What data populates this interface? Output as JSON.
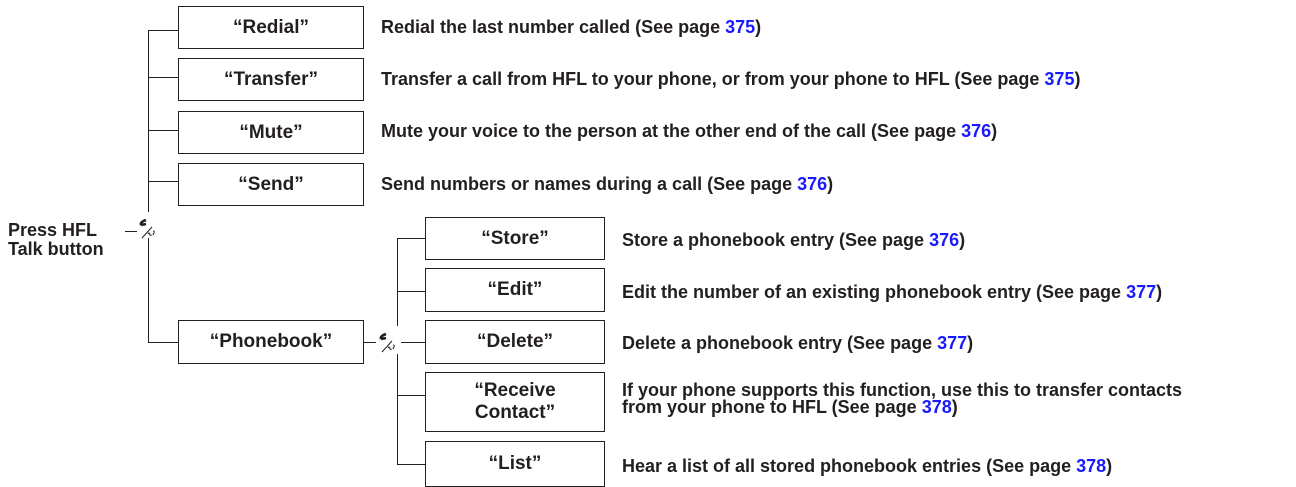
{
  "root": {
    "line1": "Press HFL",
    "line2": "Talk button"
  },
  "colors": {
    "text": "#231f20",
    "link": "#1a1aff"
  },
  "icons": [
    "voice-command-icon",
    "voice-command-icon"
  ],
  "level1": [
    {
      "key": "redial",
      "label": "“Redial”",
      "desc": "Redial the last number called (See page ",
      "page": "375",
      "tail": ")"
    },
    {
      "key": "transfer",
      "label": "“Transfer”",
      "desc": "Transfer a call from HFL to your phone, or from your phone to HFL (See page ",
      "page": "375",
      "tail": ")"
    },
    {
      "key": "mute",
      "label": "“Mute”",
      "desc": "Mute your voice to the person at the other end of the call (See page ",
      "page": "376",
      "tail": ")"
    },
    {
      "key": "send",
      "label": "“Send”",
      "desc": "Send numbers or names during a call (See page ",
      "page": "376",
      "tail": ")"
    },
    {
      "key": "phonebook",
      "label": "“Phonebook”"
    }
  ],
  "level2": [
    {
      "key": "store",
      "label": "“Store”",
      "desc": "Store a phonebook entry (See page ",
      "page": "376",
      "tail": ")"
    },
    {
      "key": "edit",
      "label": "“Edit”",
      "desc": "Edit the number of an existing phonebook entry (See page ",
      "page": "377",
      "tail": ")"
    },
    {
      "key": "delete",
      "label": "“Delete”",
      "desc": "Delete a phonebook entry (See page ",
      "page": "377",
      "tail": ")"
    },
    {
      "key": "receive-contact",
      "label": "“Receive\nContact”",
      "desc": "If your phone supports this function, use this to transfer contacts",
      "desc2": "from your phone to HFL (See page ",
      "page": "378",
      "tail": ")"
    },
    {
      "key": "list",
      "label": "“List”",
      "desc": "Hear a list of all stored phonebook entries (See page ",
      "page": "378",
      "tail": ")"
    }
  ]
}
